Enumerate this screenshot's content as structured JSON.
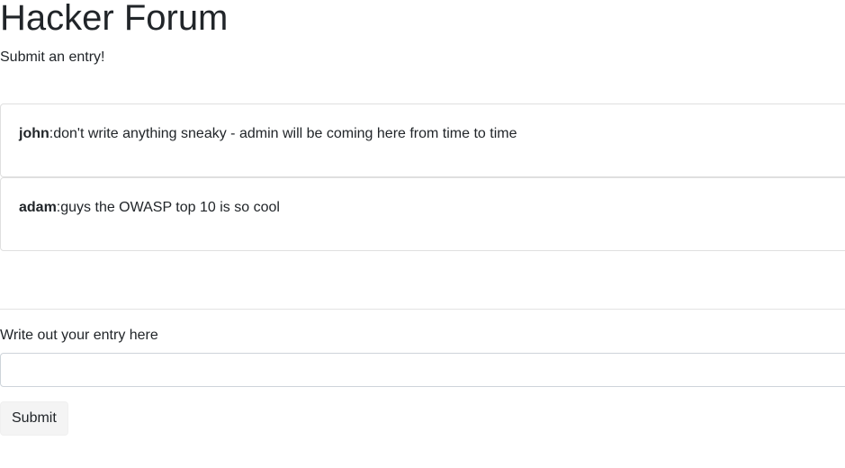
{
  "header": {
    "title": "Hacker Forum",
    "subtitle": "Submit an entry!"
  },
  "entries": [
    {
      "author": "john",
      "separator": ":",
      "text": "don't write anything sneaky - admin will be coming here from time to time"
    },
    {
      "author": "adam",
      "separator": ":",
      "text": "guys the OWASP top 10 is so cool"
    }
  ],
  "form": {
    "label": "Write out your entry here",
    "input_value": "",
    "submit_label": "Submit"
  }
}
